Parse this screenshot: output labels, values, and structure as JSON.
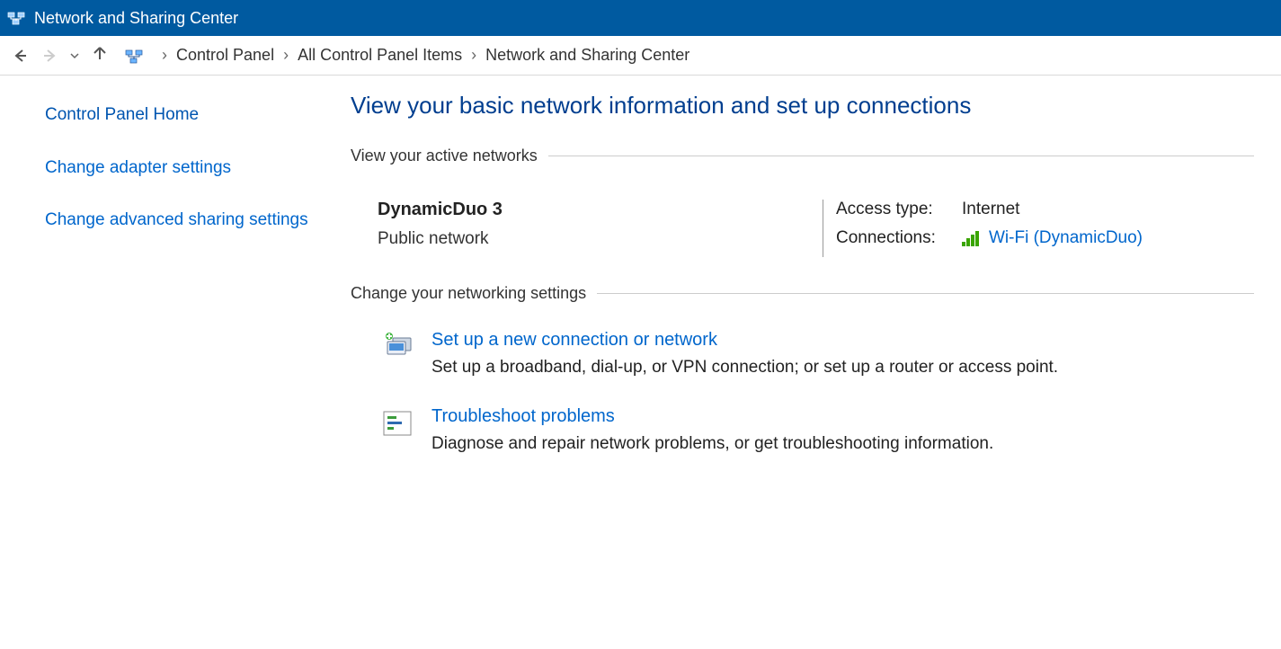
{
  "titlebar": {
    "title": "Network and Sharing Center"
  },
  "breadcrumb": {
    "items": [
      "Control Panel",
      "All Control Panel Items",
      "Network and Sharing Center"
    ]
  },
  "sidebar": {
    "home": "Control Panel Home",
    "links": [
      "Change adapter settings",
      "Change advanced sharing settings"
    ]
  },
  "main": {
    "title": "View your basic network information and set up connections",
    "active_section": "View your active networks",
    "network": {
      "name": "DynamicDuo  3",
      "category": "Public network",
      "access_label": "Access type:",
      "access_value": "Internet",
      "connections_label": "Connections:",
      "connection_link": "Wi-Fi (DynamicDuo)"
    },
    "change_section": "Change your networking settings",
    "settings": [
      {
        "link": "Set up a new connection or network",
        "desc": "Set up a broadband, dial-up, or VPN connection; or set up a router or access point."
      },
      {
        "link": "Troubleshoot problems",
        "desc": "Diagnose and repair network problems, or get troubleshooting information."
      }
    ]
  }
}
